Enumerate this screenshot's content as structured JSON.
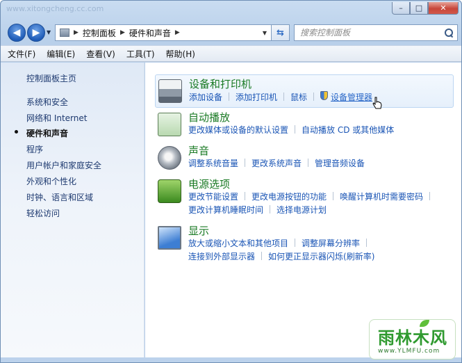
{
  "window": {
    "title_ghost": "www.xitongcheng.cc.com",
    "controls": {
      "minimize": "–",
      "maximize": "□",
      "close": "✕"
    }
  },
  "nav": {
    "back_icon": "arrow-left-icon",
    "forward_icon": "arrow-right-icon",
    "breadcrumb": [
      "控制面板",
      "硬件和声音"
    ],
    "search_placeholder": "搜索控制面板"
  },
  "menubar": [
    "文件(F)",
    "编辑(E)",
    "查看(V)",
    "工具(T)",
    "帮助(H)"
  ],
  "sidebar": {
    "items": [
      {
        "label": "控制面板主页",
        "current": false
      },
      {
        "label": "系统和安全",
        "current": false
      },
      {
        "label": "网络和 Internet",
        "current": false
      },
      {
        "label": "硬件和声音",
        "current": true
      },
      {
        "label": "程序",
        "current": false
      },
      {
        "label": "用户帐户和家庭安全",
        "current": false
      },
      {
        "label": "外观和个性化",
        "current": false
      },
      {
        "label": "时钟、语言和区域",
        "current": false
      },
      {
        "label": "轻松访问",
        "current": false
      }
    ]
  },
  "categories": [
    {
      "title": "设备和打印机",
      "icon": "printer-icon",
      "rows": [
        [
          "添加设备",
          "添加打印机",
          "鼠标",
          "设备管理器"
        ]
      ]
    },
    {
      "title": "自动播放",
      "icon": "autoplay-icon",
      "rows": [
        [
          "更改媒体或设备的默认设置",
          "自动播放 CD 或其他媒体"
        ]
      ]
    },
    {
      "title": "声音",
      "icon": "speaker-icon",
      "rows": [
        [
          "调整系统音量",
          "更改系统声音",
          "管理音频设备"
        ]
      ]
    },
    {
      "title": "电源选项",
      "icon": "battery-icon",
      "rows": [
        [
          "更改节能设置",
          "更改电源按钮的功能",
          "唤醒计算机时需要密码"
        ],
        [
          "更改计算机睡眠时间",
          "选择电源计划"
        ]
      ]
    },
    {
      "title": "显示",
      "icon": "monitor-icon",
      "rows": [
        [
          "放大或缩小文本和其他项目",
          "调整屏幕分辨率"
        ],
        [
          "连接到外部显示器",
          "如何更正显示器闪烁(刷新率)"
        ]
      ]
    }
  ],
  "watermark": {
    "main": "雨林木风",
    "sub": "www.YLMFU.com"
  },
  "colors": {
    "link": "#1a55b5",
    "category_title": "#1a7a24",
    "sidebar_link": "#1e3a70"
  }
}
